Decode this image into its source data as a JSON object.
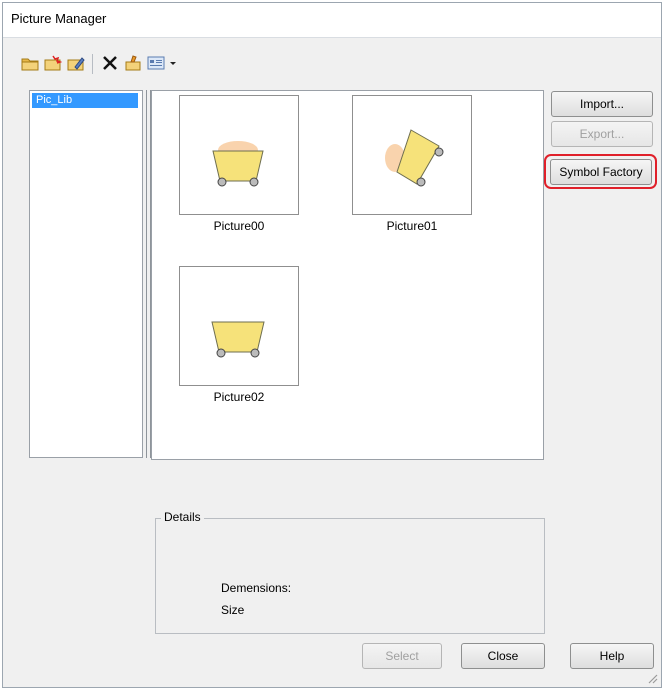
{
  "window": {
    "title": "Picture Manager"
  },
  "toolbar": {
    "buttons": [
      {
        "icon": "open-folder-icon"
      },
      {
        "icon": "new-folder-icon"
      },
      {
        "icon": "edit-folder-icon"
      },
      {
        "icon": "delete-icon"
      },
      {
        "icon": "properties-icon"
      },
      {
        "icon": "view-icon"
      },
      {
        "icon": "dropdown-arrow-icon"
      }
    ]
  },
  "library": {
    "items": [
      "Pic_Lib"
    ],
    "selected": "Pic_Lib"
  },
  "pictures": [
    {
      "name": "Picture00"
    },
    {
      "name": "Picture01"
    },
    {
      "name": "Picture02"
    }
  ],
  "side_buttons": {
    "import": "Import...",
    "export": "Export...",
    "symbol_factory": "Symbol Factory"
  },
  "details": {
    "legend": "Details",
    "dimensions_label": "Demensions:",
    "size_label": "Size"
  },
  "footer": {
    "select": "Select",
    "close": "Close",
    "help": "Help"
  },
  "colors": {
    "selection": "#3399ff",
    "highlight_ring": "#e0202a",
    "cart_fill": "#f6e27a"
  }
}
